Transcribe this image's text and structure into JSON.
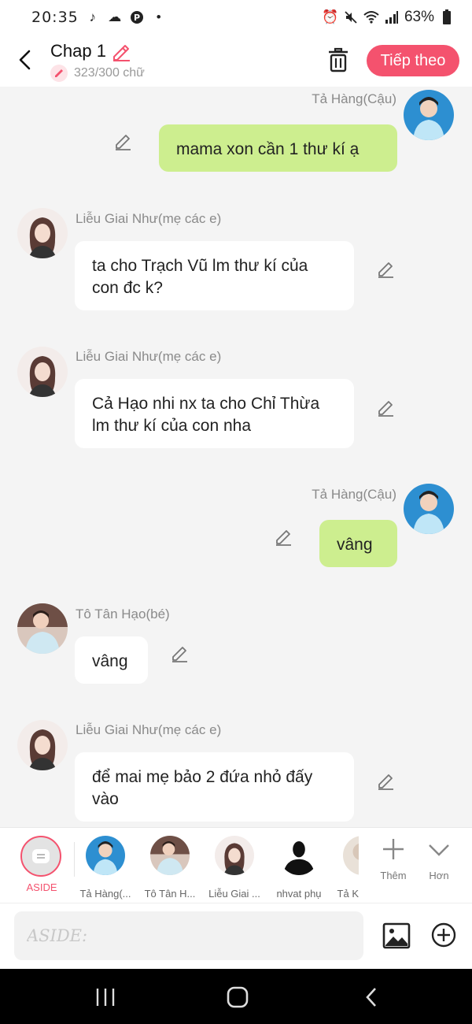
{
  "status_bar": {
    "time": "20:35",
    "battery": "63%"
  },
  "header": {
    "title": "Chap 1",
    "word_count": "323/300 chữ",
    "next_label": "Tiếp theo"
  },
  "messages": [
    {
      "side": "right",
      "name": "Tả Hàng(Cậu)",
      "text": "mama xon cần 1 thư kí ạ"
    },
    {
      "side": "left",
      "name": "Liễu Giai Như(mẹ các e)",
      "line1": "ta cho Trạch Vũ lm thư kí của",
      "line2": "con đc k?"
    },
    {
      "side": "left",
      "name": "Liễu Giai Như(mẹ các e)",
      "line1": "Cả Hạo nhi nx ta cho Chỉ Thừa",
      "line2": "lm thư kí của con nha"
    },
    {
      "side": "right",
      "name": "Tả Hàng(Cậu)",
      "text": "vâng"
    },
    {
      "side": "left",
      "name": "Tô Tân Hạo(bé)",
      "text": "vâng"
    },
    {
      "side": "left",
      "name": "Liễu Giai Như(mẹ các e)",
      "line1": "để mai mẹ bảo 2 đứa nhỏ đấy",
      "line2": "vào"
    }
  ],
  "character_bar": {
    "aside_label": "ASIDE",
    "characters": [
      {
        "label": "Tả Hàng(..."
      },
      {
        "label": "Tô Tân H..."
      },
      {
        "label": "Liễu Giai ..."
      },
      {
        "label": "nhvat phụ"
      },
      {
        "label": "Tả K"
      }
    ],
    "add_label": "Thêm",
    "more_label": "Hơn"
  },
  "input": {
    "placeholder": "ASIDE:"
  },
  "colors": {
    "accent": "#f4526e",
    "right_bubble": "#cdee8f",
    "left_bubble": "#ffffff",
    "background": "#f4f4f4"
  }
}
